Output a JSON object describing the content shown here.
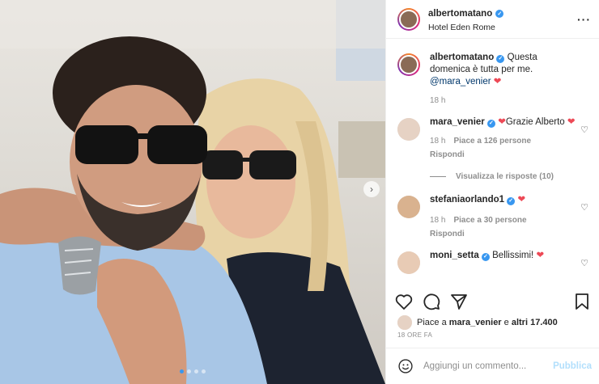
{
  "post": {
    "author": "albertomatano",
    "location": "Hotel Eden Rome",
    "caption_text": "Questa domenica è tutta per me.",
    "caption_mention": "@mara_venier",
    "caption_time": "18 h"
  },
  "comments": [
    {
      "username": "mara_venier",
      "text": "Grazie Alberto",
      "time": "18 h",
      "likes": "Piace a 126 persone",
      "reply": "Rispondi",
      "view_replies": "Visualizza le risposte (10)"
    },
    {
      "username": "stefaniaorlando1",
      "text": "",
      "time": "18 h",
      "likes": "Piace a 30 persone",
      "reply": "Rispondi"
    },
    {
      "username": "moni_setta",
      "text": "Bellissimi!"
    }
  ],
  "likes_summary": {
    "prefix": "Piace a",
    "user": "mara_venier",
    "connector": "e",
    "others": "altri 17.400"
  },
  "time_ago": "18 ORE FA",
  "add_comment": {
    "placeholder": "Aggiungi un commento...",
    "publish_label": "Pubblica"
  },
  "icons": {
    "more": "more-options-icon",
    "heart": "heart-icon",
    "comment": "comment-icon",
    "share": "share-icon",
    "save": "bookmark-icon",
    "emoji": "emoji-icon",
    "next": "chevron-right-icon"
  },
  "colors": {
    "verified": "#3897f0",
    "heart": "#ed4956",
    "publish_disabled": "#b2dffc"
  },
  "carousel": {
    "total": 4,
    "active": 1
  }
}
